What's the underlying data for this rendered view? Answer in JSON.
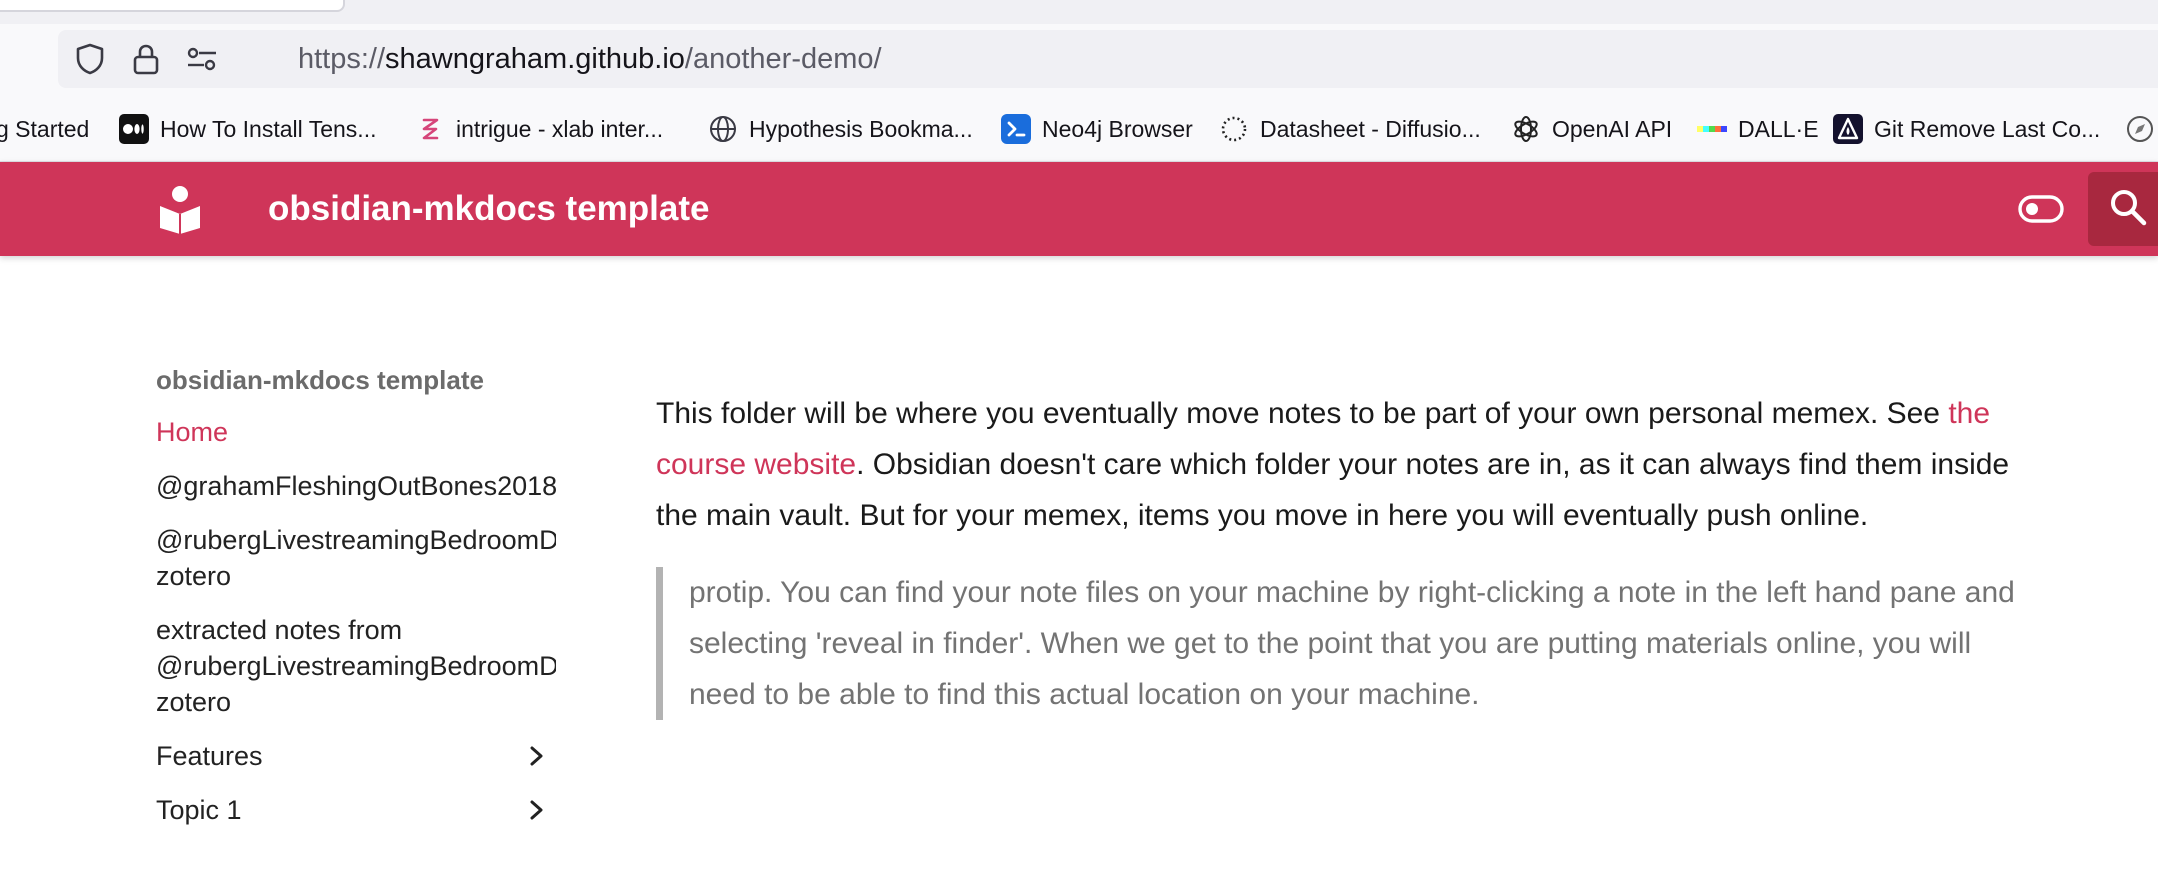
{
  "browser": {
    "url": {
      "scheme": "https://",
      "host": "shawngraham.github.io",
      "path": "/another-demo/"
    },
    "url_icons": [
      "shield-icon",
      "lock-icon",
      "permissions-icon"
    ],
    "bookmarks": [
      {
        "label": "g Started",
        "icon": "none"
      },
      {
        "label": "How To Install Tens...",
        "icon": "medium-icon"
      },
      {
        "label": "intrigue - xlab inter...",
        "icon": "intrigue-icon"
      },
      {
        "label": "Hypothesis Bookma...",
        "icon": "globe-icon"
      },
      {
        "label": "Neo4j Browser",
        "icon": "terminal-icon"
      },
      {
        "label": "Datasheet - Diffusio...",
        "icon": "dotted-circle-icon"
      },
      {
        "label": "OpenAI API",
        "icon": "openai-icon"
      },
      {
        "label": "DALL·E",
        "icon": "dalle-icon"
      },
      {
        "label": "Git Remove Last Co...",
        "icon": "git-site-icon"
      }
    ]
  },
  "header": {
    "title": "obsidian-mkdocs template",
    "brand_color": "#cf3559"
  },
  "sidebar": {
    "title": "obsidian-mkdocs template",
    "items": [
      {
        "label": "Home",
        "active": true
      },
      {
        "label": "@grahamFleshingOutBones2018"
      },
      {
        "label_line1": "@rubergLivestreamingBedroomDigital",
        "label_line2": "zotero"
      },
      {
        "label_line1": "extracted notes from",
        "label_line2": "@rubergLivestreamingBedroomDigital",
        "label_line3": "zotero"
      },
      {
        "label": "Features",
        "expandable": true
      },
      {
        "label": "Topic 1",
        "expandable": true
      }
    ]
  },
  "main": {
    "para_before_link": "This folder will be where you eventually move notes to be part of your own personal memex. See ",
    "link_text": "the course website",
    "para_after_link": ". Obsidian doesn't care which folder your notes are in, as it can always find them inside the main vault. But for your memex, items you move in here you will eventually push online.",
    "protip": "protip. You can find your note files on your machine by right-clicking a note in the left hand pane and selecting 'reveal in finder'. When we get to the point that you are putting materials online, you will need to be able to find this actual location on your machine."
  }
}
